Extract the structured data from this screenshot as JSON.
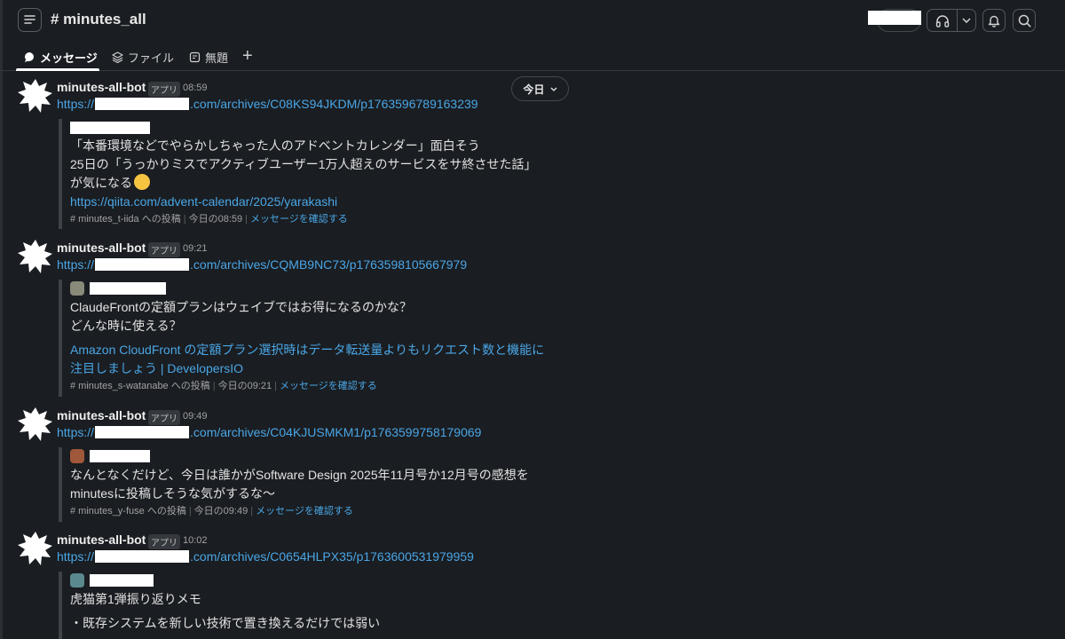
{
  "header": {
    "channel_name": "# minutes_all"
  },
  "tabs": [
    {
      "label": "メッセージ"
    },
    {
      "label": "ファイル"
    },
    {
      "label": "無題"
    }
  ],
  "date_pill": {
    "label": "今日"
  },
  "messages": [
    {
      "author": "minutes-all-bot",
      "badge": "アプリ",
      "time": "08:59",
      "url_prefix": "https://",
      "url_suffix": ".com/archives/C08KS94JKDM/p1763596789163239",
      "lines": [
        "「本番環境などでやらかしちゃった人のアドベントカレンダー」面白そう",
        "25日の「うっかりミスでアクティブユーザー1万人超えのサービスをサ終させた話」",
        "が気になる"
      ],
      "quote_link": [
        "https://qiita.com/advent-calendar/2025/yarakashi"
      ],
      "footer_channel": "# minutes_t-iida への投稿",
      "footer_time": "今日の08:59",
      "footer_link": "メッセージを確認する"
    },
    {
      "author": "minutes-all-bot",
      "badge": "アプリ",
      "time": "09:21",
      "url_prefix": "https://",
      "url_suffix": ".com/archives/CQMB9NC73/p1763598105667979",
      "lines": [
        "ClaudeFrontの定額プランはウェイブではお得になるのかな？",
        "どんな時に使える？"
      ],
      "quote_link": [
        "Amazon CloudFront の定額プラン選択時はデータ転送量よりもリクエスト数と機能に",
        "注目しましょう | DevelopersIO"
      ],
      "footer_channel": "# minutes_s-watanabe への投稿",
      "footer_time": "今日の09:21",
      "footer_link": "メッセージを確認する"
    },
    {
      "author": "minutes-all-bot",
      "badge": "アプリ",
      "time": "09:49",
      "url_prefix": "https://",
      "url_suffix": ".com/archives/C04KJUSMKM1/p1763599758179069",
      "lines": [
        "なんとなくだけど、今日は誰かがSoftware Design 2025年11月号か12月号の感想を",
        "minutesに投稿しそうな気がするな〜"
      ],
      "quote_link": [],
      "footer_channel": "# minutes_y-fuse への投稿",
      "footer_time": "今日の09:49",
      "footer_link": "メッセージを確認する"
    },
    {
      "author": "minutes-all-bot",
      "badge": "アプリ",
      "time": "10:02",
      "url_prefix": "https://",
      "url_suffix": ".com/archives/C0654HLPX35/p1763600531979959",
      "lines": [
        "虎猫第1弾振り返りメモ",
        "・既存システムを新しい技術で置き換えるだけでは弱い"
      ],
      "quote_link": [],
      "footer_channel": "",
      "footer_time": "",
      "footer_link": ""
    }
  ],
  "colors": {
    "background": "#1a1d21",
    "link": "#4aa6e6",
    "redaction": "#ffffff"
  }
}
